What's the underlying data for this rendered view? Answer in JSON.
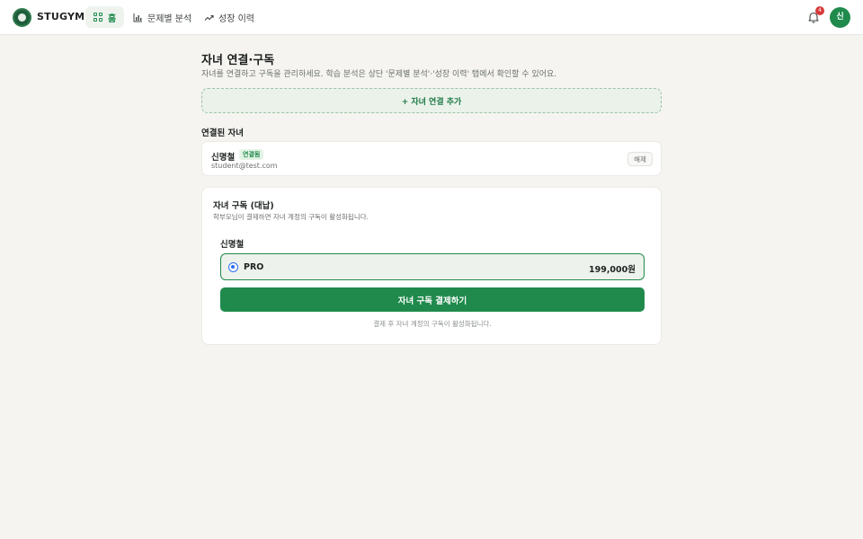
{
  "header": {
    "brand": "STUGYM",
    "nav": [
      {
        "label": "홈",
        "active": true
      },
      {
        "label": "문제별 분석",
        "active": false
      },
      {
        "label": "성장 이력",
        "active": false
      }
    ],
    "notification_count": "4",
    "avatar_initial": "신"
  },
  "main": {
    "title": "자녀 연결·구독",
    "subtitle": "자녀를 연결하고 구독을 관리하세요. 학습 분석은 상단 '문제별 분석'·'성장 이력' 탭에서 확인할 수 있어요.",
    "add_child_label": "+ 자녀 연결 추가",
    "connected_section_title": "연결된 자녀",
    "children": [
      {
        "name": "신명철",
        "status": "연결됨",
        "email": "student@test.com",
        "unlink_label": "해제"
      }
    ],
    "subscription": {
      "title": "자녀 구독 (대납)",
      "description": "학부모님이 결제하면 자녀 계정의 구독이 활성화됩니다.",
      "child_name": "신명철",
      "plan_name": "PRO",
      "plan_price": "199,000원",
      "pay_button_label": "자녀 구독 결제하기",
      "note": "결제 후 자녀 계정의 구독이 활성화됩니다."
    }
  },
  "colors": {
    "accent": "#1f8a4c",
    "background": "#f5f4f0",
    "badge_red": "#d93a3a",
    "radio_blue": "#2a6ff0"
  },
  "icons": {
    "logo": "stugym-logo-icon",
    "home": "grid-icon",
    "analysis": "bar-chart-icon",
    "history": "trend-up-icon",
    "notifications": "bell-icon"
  }
}
